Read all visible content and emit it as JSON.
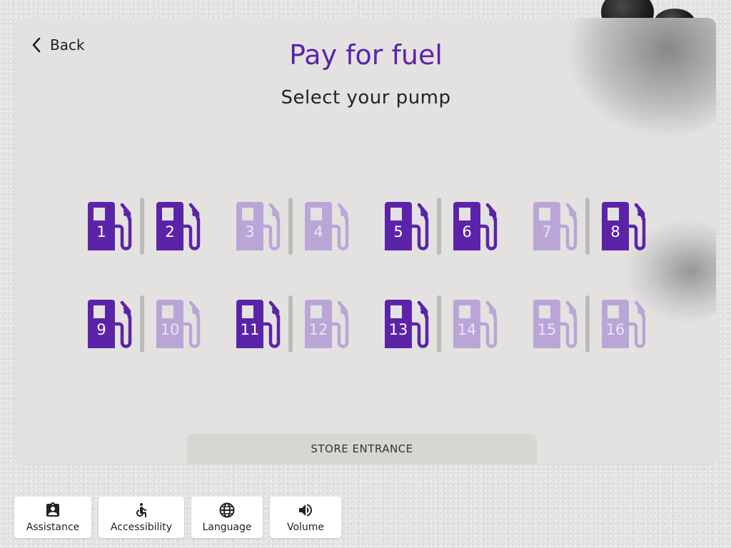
{
  "header": {
    "back_label": "Back",
    "title": "Pay for fuel",
    "subtitle": "Select your pump"
  },
  "colors": {
    "accent": "#5b24a8",
    "pump_available": "#5b24a8",
    "pump_unavailable": "#b9a6d6"
  },
  "pumps": [
    {
      "label": "1",
      "available": true
    },
    {
      "label": "2",
      "available": true
    },
    {
      "label": "3",
      "available": false
    },
    {
      "label": "4",
      "available": false
    },
    {
      "label": "5",
      "available": true
    },
    {
      "label": "6",
      "available": true
    },
    {
      "label": "7",
      "available": false
    },
    {
      "label": "8",
      "available": true
    },
    {
      "label": "9",
      "available": true
    },
    {
      "label": "10",
      "available": false
    },
    {
      "label": "11",
      "available": true
    },
    {
      "label": "12",
      "available": false
    },
    {
      "label": "13",
      "available": true
    },
    {
      "label": "14",
      "available": false
    },
    {
      "label": "15",
      "available": false
    },
    {
      "label": "16",
      "available": false
    }
  ],
  "store_entrance": "STORE ENTRANCE",
  "footer": {
    "buttons": [
      {
        "label": "Assistance",
        "icon": "assistance-badge-icon"
      },
      {
        "label": "Accessibility",
        "icon": "accessibility-icon"
      },
      {
        "label": "Language",
        "icon": "globe-icon"
      },
      {
        "label": "Volume",
        "icon": "volume-icon"
      }
    ]
  }
}
